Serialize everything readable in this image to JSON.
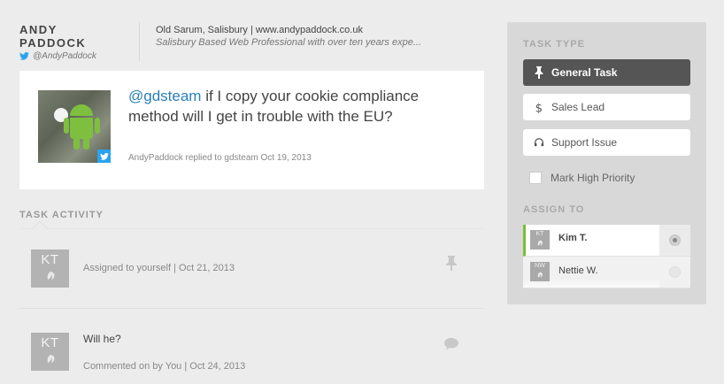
{
  "profile": {
    "first_name": "ANDY",
    "last_name": "PADDOCK",
    "handle": "@AndyPaddock",
    "location": "Old Sarum, Salisbury | www.andypaddock.co.uk",
    "bio": "Salisbury Based Web Professional with over ten years expe..."
  },
  "tweet": {
    "mention": "@gdsteam",
    "text": " if I copy your cookie compliance method will I get in trouble with the EU?",
    "meta": "AndyPaddock replied to gdsteam Oct 19, 2013"
  },
  "activity": {
    "heading": "TASK ACTIVITY",
    "items": [
      {
        "initials": "KT",
        "text": "Assigned to yourself | Oct 21, 2013",
        "icon": "pin-icon"
      },
      {
        "initials": "KT",
        "title": "Will he?",
        "text": "Commented on by You | Oct 24, 2013",
        "icon": "comment-icon"
      }
    ]
  },
  "panel": {
    "task_type_heading": "TASK TYPE",
    "task_types": [
      {
        "label": "General Task",
        "icon": "pin-icon",
        "selected": true
      },
      {
        "label": "Sales Lead",
        "icon": "dollar-icon",
        "selected": false
      },
      {
        "label": "Support Issue",
        "icon": "headset-icon",
        "selected": false
      }
    ],
    "high_priority_label": "Mark High Priority",
    "high_priority_checked": false,
    "assign_heading": "ASSIGN TO",
    "assignees": [
      {
        "initials": "KT",
        "name": "Kim T.",
        "selected": true
      },
      {
        "initials": "NW",
        "name": "Nettie W.",
        "selected": false
      }
    ]
  },
  "colors": {
    "accent_green": "#7dbd3a",
    "twitter_blue": "#2aa3ef",
    "mention_blue": "#2a7fb8",
    "active_button": "#555555"
  }
}
